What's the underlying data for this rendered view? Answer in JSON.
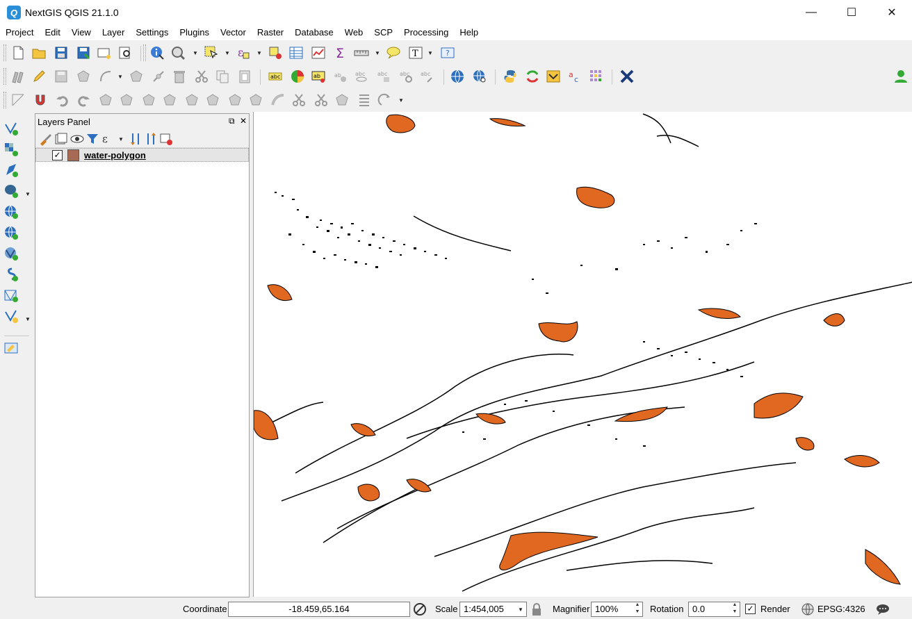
{
  "window": {
    "title": "NextGIS QGIS 21.1.0",
    "minimize": "—",
    "maximize": "☐",
    "close": "✕"
  },
  "menu": [
    "Project",
    "Edit",
    "View",
    "Layer",
    "Settings",
    "Plugins",
    "Vector",
    "Raster",
    "Database",
    "Web",
    "SCP",
    "Processing",
    "Help"
  ],
  "layers_panel": {
    "title": "Layers Panel",
    "layers": [
      {
        "name": "water-polygon",
        "visible": true,
        "color": "#a76a55"
      }
    ]
  },
  "status": {
    "coordinate_label": "Coordinate",
    "coordinate": "-18.459,65.164",
    "scale_label": "Scale",
    "scale": "1:454,005",
    "magnifier_label": "Magnifier",
    "magnifier": "100%",
    "rotation_label": "Rotation",
    "rotation": "0.0",
    "render_label": "Render",
    "crs": "EPSG:4326"
  },
  "colors": {
    "water": "#e06820",
    "outline": "#000000",
    "accent": "#2a8fd8"
  }
}
